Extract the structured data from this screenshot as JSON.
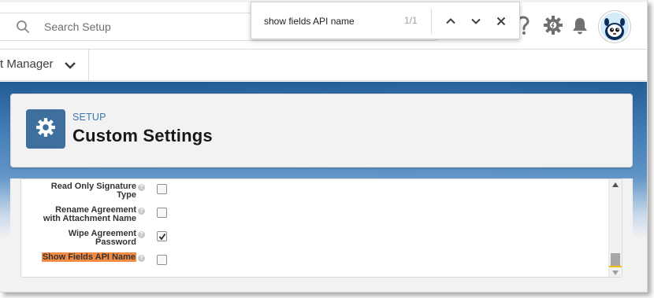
{
  "search": {
    "placeholder": "Search Setup"
  },
  "find_bar": {
    "query": "show fields API name",
    "match_count": "1/1"
  },
  "nav": {
    "app_name": "t Manager"
  },
  "header": {
    "breadcrumb": "SETUP",
    "title": "Custom Settings"
  },
  "settings": [
    {
      "label": "Read Only Signature\nType",
      "checked": false,
      "highlighted": false
    },
    {
      "label": "Rename Agreement\nwith Attachment Name",
      "checked": false,
      "highlighted": false
    },
    {
      "label": "Wipe Agreement\nPassword",
      "checked": true,
      "highlighted": false
    },
    {
      "label": "Show Fields API Name",
      "checked": false,
      "highlighted": true
    }
  ],
  "help_glyph": "?",
  "colors": {
    "accent_blue": "#2e69a4",
    "setup_icon_bg": "#3f6f9d",
    "highlight": "#f38b44",
    "breadcrumb": "#3b73b0"
  },
  "icons": {
    "search": "search-icon",
    "help": "help-icon",
    "setup_gear": "gear-icon",
    "notifications": "bell-icon",
    "avatar": "astro-avatar",
    "find_prev": "chevron-up-icon",
    "find_next": "chevron-down-icon",
    "find_close": "close-icon",
    "app_menu": "chevron-down-icon",
    "page_icon": "gear-icon"
  }
}
